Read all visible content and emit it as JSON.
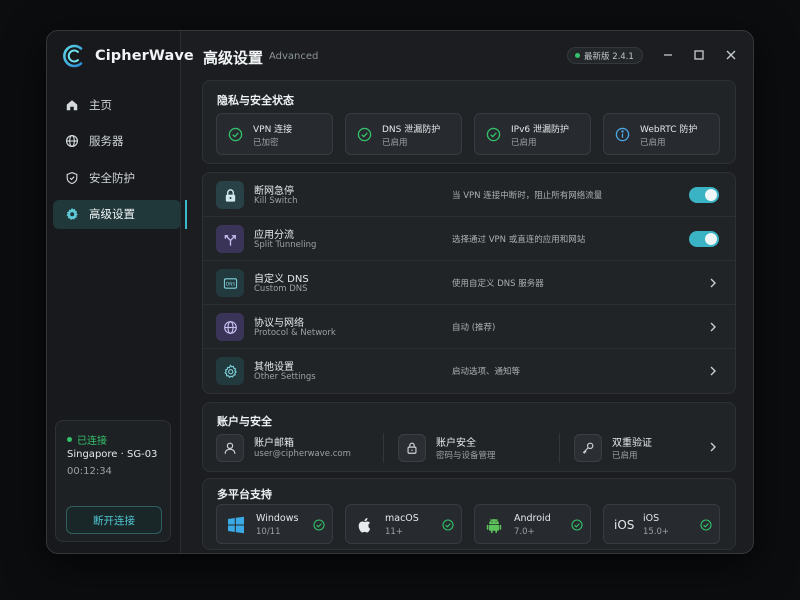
{
  "app": {
    "name": "CipherWave"
  },
  "sidebar": {
    "items": [
      {
        "label": "主页",
        "icon": "home-icon"
      },
      {
        "label": "服务器",
        "icon": "globe-icon"
      },
      {
        "label": "安全防护",
        "icon": "shield-icon"
      },
      {
        "label": "高级设置",
        "icon": "gear-icon",
        "active": true
      }
    ],
    "connection": {
      "status": "已连接",
      "server": "Singapore · SG-03",
      "duration": "00:12:34",
      "disconnect_label": "断开连接"
    }
  },
  "header": {
    "title": "高级设置",
    "subtitle": "Advanced",
    "version_badge": "最新版 2.4.1"
  },
  "privacy": {
    "title": "隐私与安全状态",
    "cards": [
      {
        "label": "VPN 连接",
        "status": "已加密",
        "icon": "check-circle-icon"
      },
      {
        "label": "DNS 泄漏防护",
        "status": "已启用",
        "icon": "check-circle-icon"
      },
      {
        "label": "IPv6 泄漏防护",
        "status": "已启用",
        "icon": "check-circle-icon"
      },
      {
        "label": "WebRTC 防护",
        "status": "已启用",
        "icon": "info-circle-icon"
      }
    ]
  },
  "settings": [
    {
      "title": "断网急停",
      "subtitle": "Kill Switch",
      "desc": "当 VPN 连接中断时，阻止所有网络流量",
      "control": "toggle",
      "on": true,
      "icon": "lock-icon"
    },
    {
      "title": "应用分流",
      "subtitle": "Split Tunneling",
      "desc": "选择通过 VPN 或直连的应用和网站",
      "control": "toggle",
      "on": true,
      "icon": "split-arrows-icon"
    },
    {
      "title": "自定义 DNS",
      "subtitle": "Custom DNS",
      "desc": "使用自定义 DNS 服务器",
      "control": "chevron",
      "icon": "dns-icon",
      "icon_text": "DNS"
    },
    {
      "title": "协议与网络",
      "subtitle": "Protocol & Network",
      "desc": "自动 (推荐)",
      "control": "chevron",
      "icon": "globe-icon"
    },
    {
      "title": "其他设置",
      "subtitle": "Other Settings",
      "desc": "启动选项、通知等",
      "control": "chevron",
      "icon": "gear-icon"
    }
  ],
  "account": {
    "title": "账户与安全",
    "items": [
      {
        "title": "账户邮箱",
        "value": "user@cipherwave.com",
        "icon": "user-icon"
      },
      {
        "title": "账户安全",
        "value": "密码与设备管理",
        "icon": "padlock-icon"
      },
      {
        "title": "双重验证",
        "value": "已启用",
        "icon": "key-icon"
      }
    ]
  },
  "platforms": {
    "title": "多平台支持",
    "items": [
      {
        "name": "Windows",
        "version": "10/11",
        "icon": "windows-icon"
      },
      {
        "name": "macOS",
        "version": "11+",
        "icon": "apple-icon"
      },
      {
        "name": "Android",
        "version": "7.0+",
        "icon": "android-icon"
      },
      {
        "name": "iOS",
        "version": "15.0+",
        "icon": "ios-icon",
        "icon_text": "iOS"
      }
    ]
  },
  "colors": {
    "accent": "#3ab9c8",
    "success": "#33c26b",
    "info": "#4aa8e8",
    "background": "#1b1d20"
  }
}
